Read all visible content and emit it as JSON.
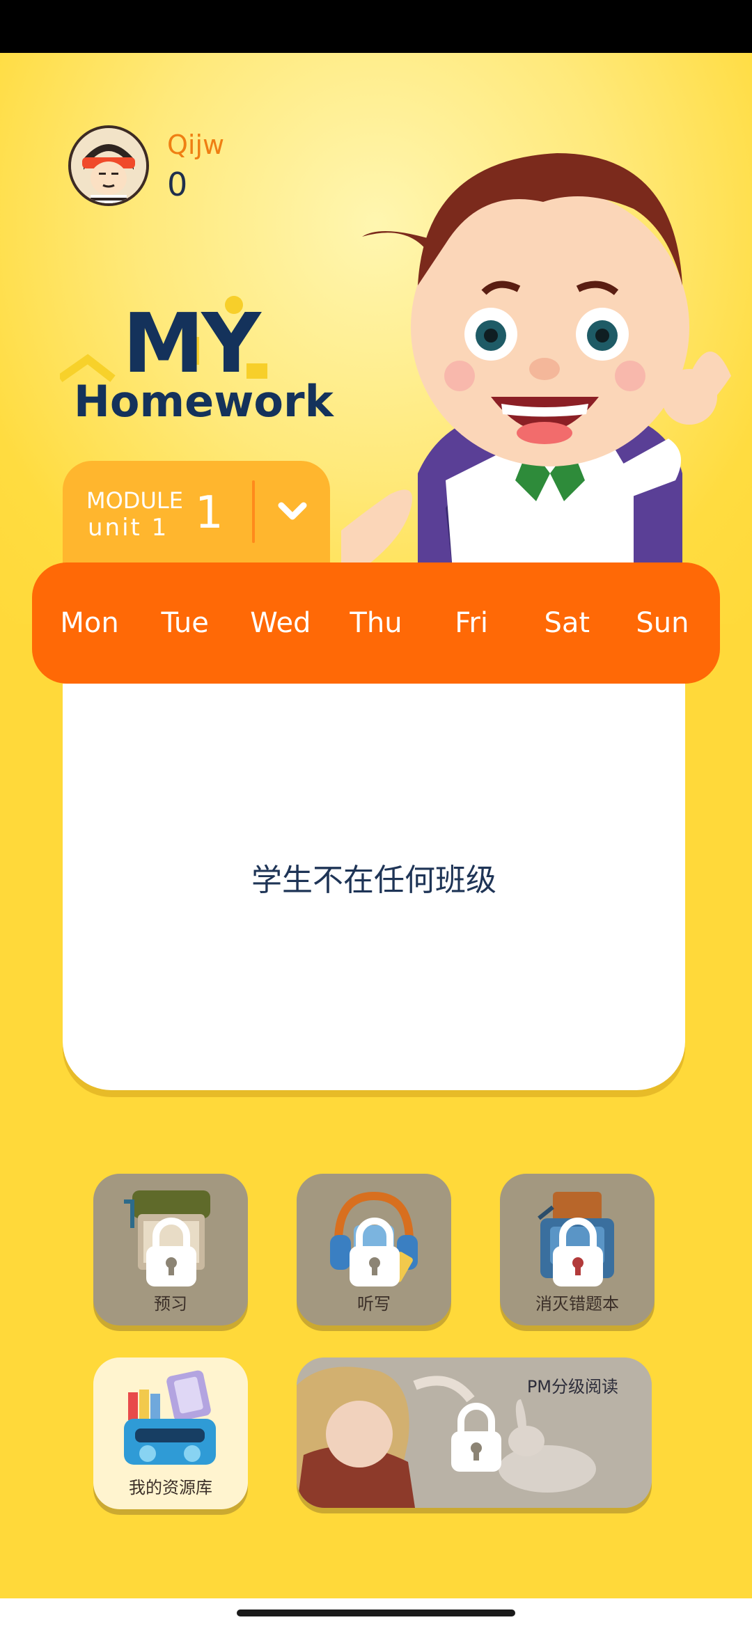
{
  "user": {
    "name": "Qijw",
    "points": "0"
  },
  "logo": {
    "line1": "MY",
    "line2": "Homework"
  },
  "module": {
    "title": "MODULE",
    "unit": "unit 1",
    "number": "1"
  },
  "weekdays": [
    "Mon",
    "Tue",
    "Wed",
    "Thu",
    "Fri",
    "Sat",
    "Sun"
  ],
  "content": {
    "empty_message": "学生不在任何班级"
  },
  "tiles": [
    {
      "label": "预习",
      "locked": true,
      "icon": "preview-book-icon"
    },
    {
      "label": "听写",
      "locked": true,
      "icon": "dictation-headphones-icon"
    },
    {
      "label": "消灭错题本",
      "locked": true,
      "icon": "mistakes-book-icon"
    },
    {
      "label": "我的资源库",
      "locked": false,
      "icon": "resource-library-icon"
    }
  ],
  "banner": {
    "title": "PM分级阅读",
    "locked": true
  },
  "colors": {
    "orange": "#ff6906",
    "module": "#ffb62e",
    "navy": "#14325b",
    "background": "#ffd93a"
  }
}
